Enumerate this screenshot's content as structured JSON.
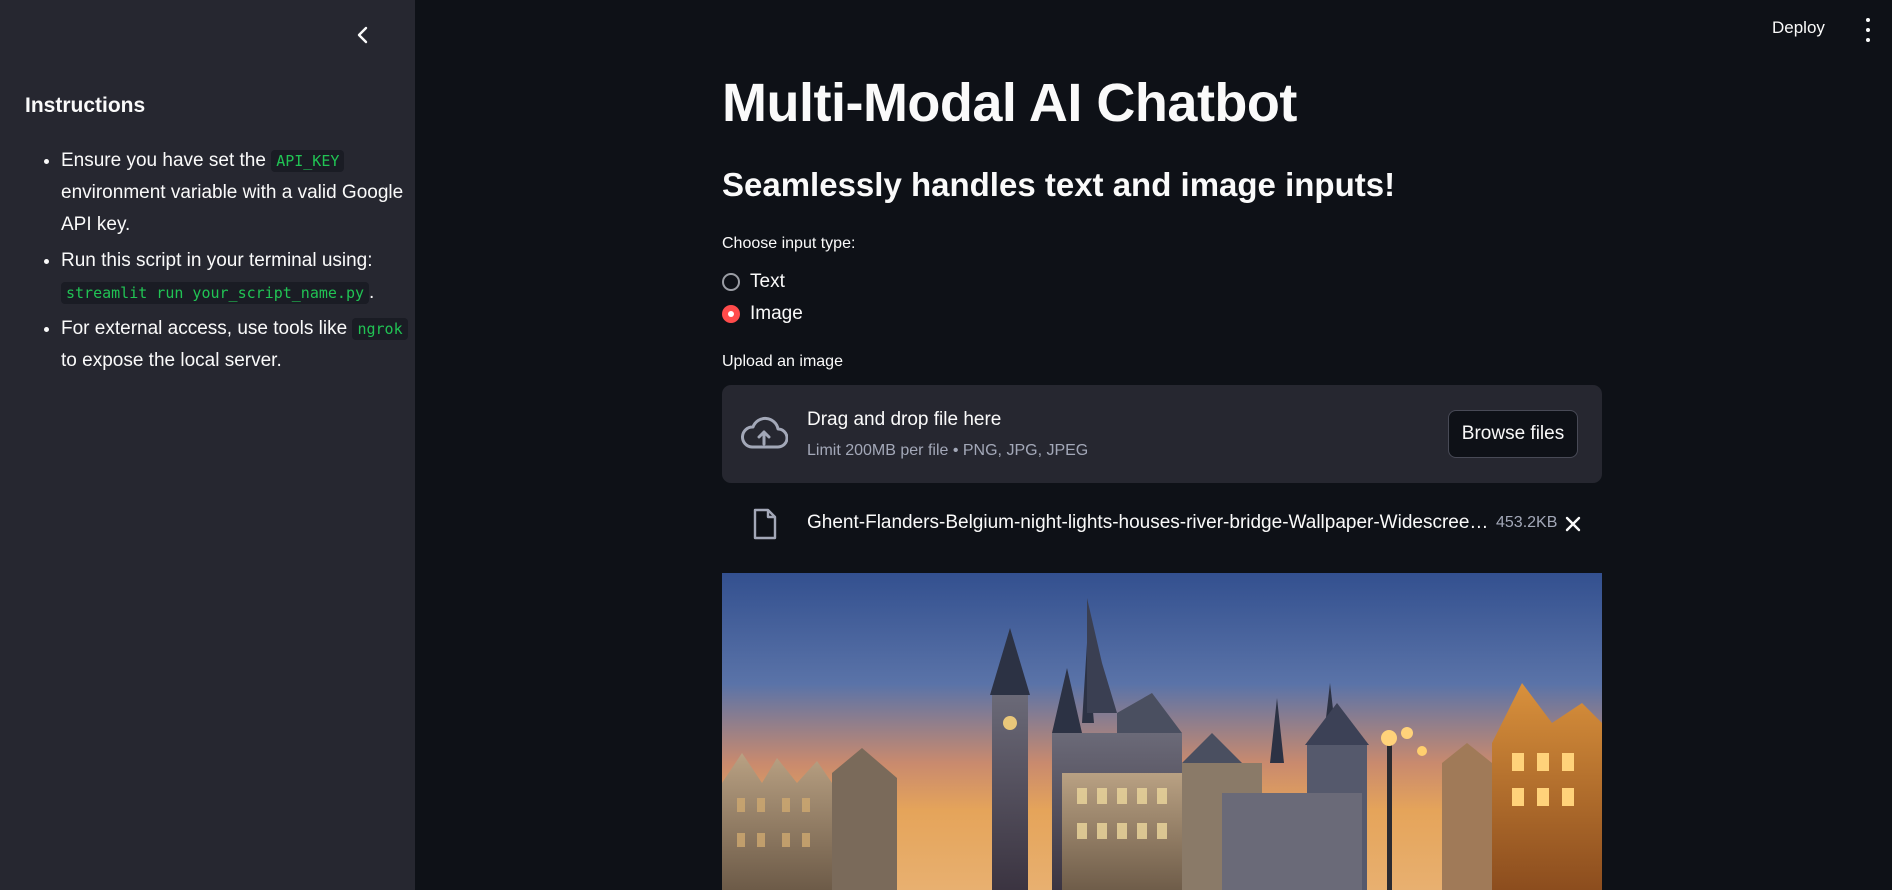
{
  "sidebar": {
    "collapse_icon": "chevron-left-icon",
    "title": "Instructions",
    "items": [
      {
        "pre": "Ensure you have set the ",
        "code": "API_KEY",
        "post": " environment variable with a valid Google API key."
      },
      {
        "pre": "Run this script in your terminal using: ",
        "code": "streamlit run your_script_name.py",
        "post": "."
      },
      {
        "pre": "For external access, use tools like ",
        "code": "ngrok",
        "post": " to expose the local server."
      }
    ]
  },
  "topbar": {
    "deploy_label": "Deploy",
    "menu_icon": "kebab-menu-icon"
  },
  "main": {
    "title": "Multi-Modal AI Chatbot",
    "subtitle": "Seamlessly handles text and image inputs!",
    "input_type": {
      "label": "Choose input type:",
      "options": [
        "Text",
        "Image"
      ],
      "selected": "Image"
    },
    "uploader": {
      "label": "Upload an image",
      "drop_text": "Drag and drop file here",
      "limit_text": "Limit 200MB per file • PNG, JPG, JPEG",
      "browse_label": "Browse files",
      "icon": "cloud-upload-icon"
    },
    "file": {
      "name": "Ghent-Flanders-Belgium-night-lights-houses-river-bridge-Wallpaper-Widescree…",
      "size": "453.2KB",
      "icon": "file-icon",
      "remove_icon": "close-icon"
    },
    "preview_icon": "uploaded-image-preview"
  },
  "colors": {
    "background": "#0e1117",
    "sidebar": "#262730",
    "accent": "#ff4b4b",
    "code": "#21c354"
  }
}
